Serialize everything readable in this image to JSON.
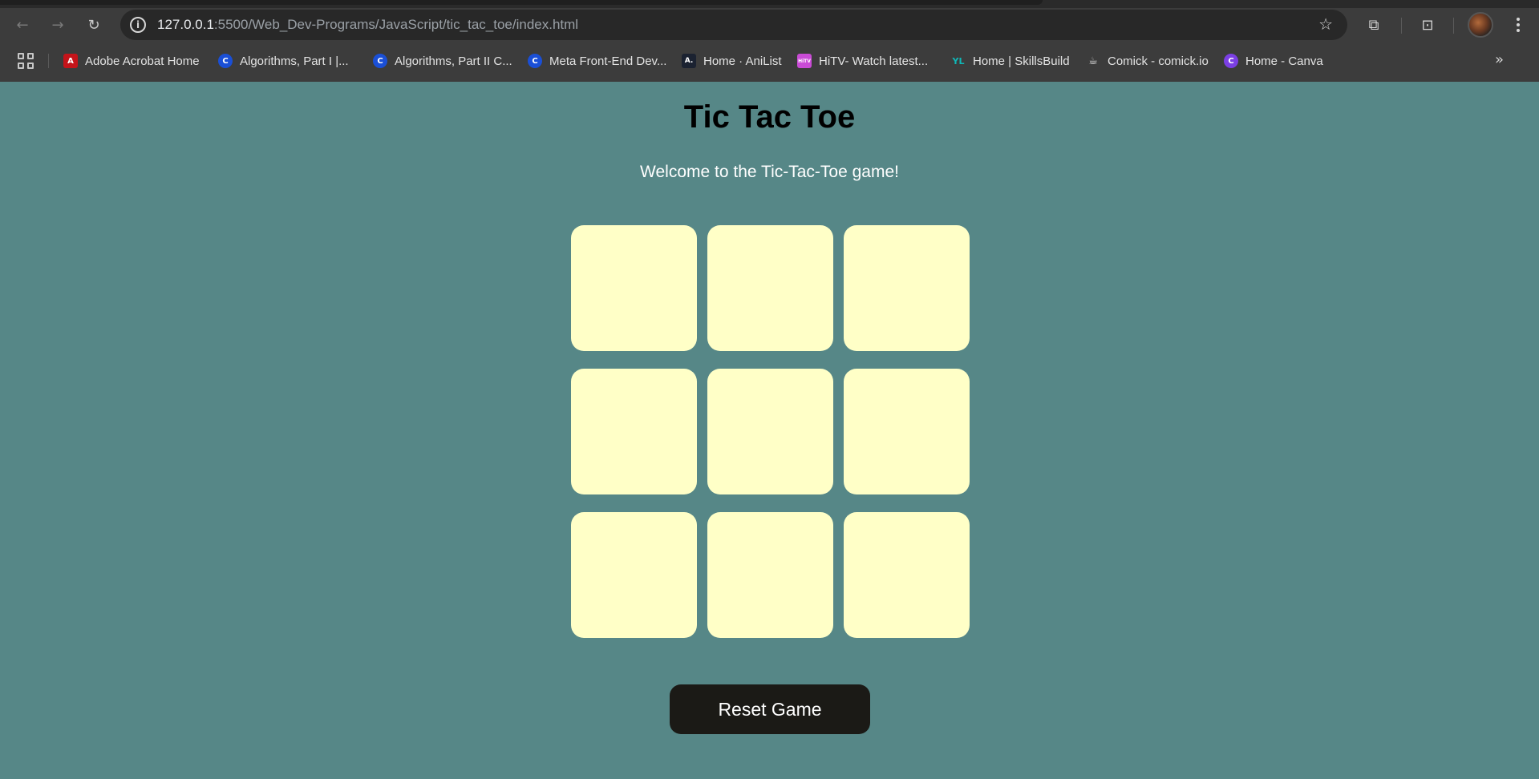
{
  "browser": {
    "nav": {
      "back_icon": "←",
      "forward_icon": "→",
      "reload_icon": "↻"
    },
    "omnibox": {
      "host": "127.0.0.1",
      "rest": ":5500/Web_Dev-Programs/JavaScript/tic_tac_toe/index.html",
      "info_icon": "i",
      "star_icon": "☆"
    },
    "right_icons": {
      "extensions": "⧉",
      "screenshot": "⊡"
    },
    "bookmarks": [
      {
        "label": "Adobe Acrobat Home",
        "fav": "A",
        "color": "#c4141a",
        "shape": "square"
      },
      {
        "label": "Algorithms, Part I |...",
        "fav": "C",
        "color": "#1a4fd6",
        "shape": "circle"
      },
      {
        "label": "Algorithms, Part II C...",
        "fav": "C",
        "color": "#1a4fd6",
        "shape": "circle"
      },
      {
        "label": "Meta Front-End Dev...",
        "fav": "C",
        "color": "#1a4fd6",
        "shape": "circle"
      },
      {
        "label": "Home · AniList",
        "fav": "A.",
        "color": "#1b2231",
        "shape": "square"
      },
      {
        "label": "HiTV- Watch latest...",
        "fav": "HiTV",
        "color": "#c94bd6",
        "shape": "square"
      },
      {
        "label": "Home | SkillsBuild",
        "fav": "YL",
        "color": "#0fb8b8",
        "shape": "square"
      },
      {
        "label": "Comick - comick.io",
        "fav": "☕",
        "color": "#6b6b6b",
        "shape": "square"
      },
      {
        "label": "Home - Canva",
        "fav": "C",
        "color": "#7b3fe4",
        "shape": "circle"
      }
    ],
    "more_icon": "»"
  },
  "page": {
    "title": "Tic Tac Toe",
    "subtitle": "Welcome to the Tic-Tac-Toe game!",
    "board": [
      "",
      "",
      "",
      "",
      "",
      "",
      "",
      "",
      ""
    ],
    "reset_label": "Reset Game"
  },
  "colors": {
    "background": "#568787",
    "cell": "#ffffc7",
    "reset_button": "#1b1a16"
  }
}
